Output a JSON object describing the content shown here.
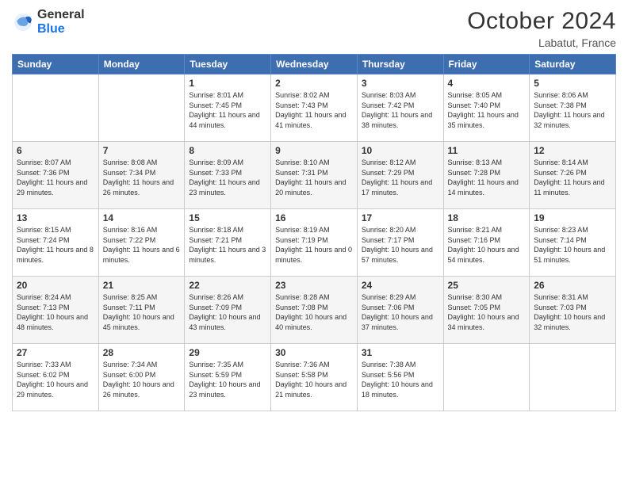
{
  "header": {
    "logo_line1": "General",
    "logo_line2": "Blue",
    "month_title": "October 2024",
    "location": "Labatut, France"
  },
  "weekdays": [
    "Sunday",
    "Monday",
    "Tuesday",
    "Wednesday",
    "Thursday",
    "Friday",
    "Saturday"
  ],
  "weeks": [
    [
      {
        "day": "",
        "sunrise": "",
        "sunset": "",
        "daylight": ""
      },
      {
        "day": "",
        "sunrise": "",
        "sunset": "",
        "daylight": ""
      },
      {
        "day": "1",
        "sunrise": "Sunrise: 8:01 AM",
        "sunset": "Sunset: 7:45 PM",
        "daylight": "Daylight: 11 hours and 44 minutes."
      },
      {
        "day": "2",
        "sunrise": "Sunrise: 8:02 AM",
        "sunset": "Sunset: 7:43 PM",
        "daylight": "Daylight: 11 hours and 41 minutes."
      },
      {
        "day": "3",
        "sunrise": "Sunrise: 8:03 AM",
        "sunset": "Sunset: 7:42 PM",
        "daylight": "Daylight: 11 hours and 38 minutes."
      },
      {
        "day": "4",
        "sunrise": "Sunrise: 8:05 AM",
        "sunset": "Sunset: 7:40 PM",
        "daylight": "Daylight: 11 hours and 35 minutes."
      },
      {
        "day": "5",
        "sunrise": "Sunrise: 8:06 AM",
        "sunset": "Sunset: 7:38 PM",
        "daylight": "Daylight: 11 hours and 32 minutes."
      }
    ],
    [
      {
        "day": "6",
        "sunrise": "Sunrise: 8:07 AM",
        "sunset": "Sunset: 7:36 PM",
        "daylight": "Daylight: 11 hours and 29 minutes."
      },
      {
        "day": "7",
        "sunrise": "Sunrise: 8:08 AM",
        "sunset": "Sunset: 7:34 PM",
        "daylight": "Daylight: 11 hours and 26 minutes."
      },
      {
        "day": "8",
        "sunrise": "Sunrise: 8:09 AM",
        "sunset": "Sunset: 7:33 PM",
        "daylight": "Daylight: 11 hours and 23 minutes."
      },
      {
        "day": "9",
        "sunrise": "Sunrise: 8:10 AM",
        "sunset": "Sunset: 7:31 PM",
        "daylight": "Daylight: 11 hours and 20 minutes."
      },
      {
        "day": "10",
        "sunrise": "Sunrise: 8:12 AM",
        "sunset": "Sunset: 7:29 PM",
        "daylight": "Daylight: 11 hours and 17 minutes."
      },
      {
        "day": "11",
        "sunrise": "Sunrise: 8:13 AM",
        "sunset": "Sunset: 7:28 PM",
        "daylight": "Daylight: 11 hours and 14 minutes."
      },
      {
        "day": "12",
        "sunrise": "Sunrise: 8:14 AM",
        "sunset": "Sunset: 7:26 PM",
        "daylight": "Daylight: 11 hours and 11 minutes."
      }
    ],
    [
      {
        "day": "13",
        "sunrise": "Sunrise: 8:15 AM",
        "sunset": "Sunset: 7:24 PM",
        "daylight": "Daylight: 11 hours and 8 minutes."
      },
      {
        "day": "14",
        "sunrise": "Sunrise: 8:16 AM",
        "sunset": "Sunset: 7:22 PM",
        "daylight": "Daylight: 11 hours and 6 minutes."
      },
      {
        "day": "15",
        "sunrise": "Sunrise: 8:18 AM",
        "sunset": "Sunset: 7:21 PM",
        "daylight": "Daylight: 11 hours and 3 minutes."
      },
      {
        "day": "16",
        "sunrise": "Sunrise: 8:19 AM",
        "sunset": "Sunset: 7:19 PM",
        "daylight": "Daylight: 11 hours and 0 minutes."
      },
      {
        "day": "17",
        "sunrise": "Sunrise: 8:20 AM",
        "sunset": "Sunset: 7:17 PM",
        "daylight": "Daylight: 10 hours and 57 minutes."
      },
      {
        "day": "18",
        "sunrise": "Sunrise: 8:21 AM",
        "sunset": "Sunset: 7:16 PM",
        "daylight": "Daylight: 10 hours and 54 minutes."
      },
      {
        "day": "19",
        "sunrise": "Sunrise: 8:23 AM",
        "sunset": "Sunset: 7:14 PM",
        "daylight": "Daylight: 10 hours and 51 minutes."
      }
    ],
    [
      {
        "day": "20",
        "sunrise": "Sunrise: 8:24 AM",
        "sunset": "Sunset: 7:13 PM",
        "daylight": "Daylight: 10 hours and 48 minutes."
      },
      {
        "day": "21",
        "sunrise": "Sunrise: 8:25 AM",
        "sunset": "Sunset: 7:11 PM",
        "daylight": "Daylight: 10 hours and 45 minutes."
      },
      {
        "day": "22",
        "sunrise": "Sunrise: 8:26 AM",
        "sunset": "Sunset: 7:09 PM",
        "daylight": "Daylight: 10 hours and 43 minutes."
      },
      {
        "day": "23",
        "sunrise": "Sunrise: 8:28 AM",
        "sunset": "Sunset: 7:08 PM",
        "daylight": "Daylight: 10 hours and 40 minutes."
      },
      {
        "day": "24",
        "sunrise": "Sunrise: 8:29 AM",
        "sunset": "Sunset: 7:06 PM",
        "daylight": "Daylight: 10 hours and 37 minutes."
      },
      {
        "day": "25",
        "sunrise": "Sunrise: 8:30 AM",
        "sunset": "Sunset: 7:05 PM",
        "daylight": "Daylight: 10 hours and 34 minutes."
      },
      {
        "day": "26",
        "sunrise": "Sunrise: 8:31 AM",
        "sunset": "Sunset: 7:03 PM",
        "daylight": "Daylight: 10 hours and 32 minutes."
      }
    ],
    [
      {
        "day": "27",
        "sunrise": "Sunrise: 7:33 AM",
        "sunset": "Sunset: 6:02 PM",
        "daylight": "Daylight: 10 hours and 29 minutes."
      },
      {
        "day": "28",
        "sunrise": "Sunrise: 7:34 AM",
        "sunset": "Sunset: 6:00 PM",
        "daylight": "Daylight: 10 hours and 26 minutes."
      },
      {
        "day": "29",
        "sunrise": "Sunrise: 7:35 AM",
        "sunset": "Sunset: 5:59 PM",
        "daylight": "Daylight: 10 hours and 23 minutes."
      },
      {
        "day": "30",
        "sunrise": "Sunrise: 7:36 AM",
        "sunset": "Sunset: 5:58 PM",
        "daylight": "Daylight: 10 hours and 21 minutes."
      },
      {
        "day": "31",
        "sunrise": "Sunrise: 7:38 AM",
        "sunset": "Sunset: 5:56 PM",
        "daylight": "Daylight: 10 hours and 18 minutes."
      },
      {
        "day": "",
        "sunrise": "",
        "sunset": "",
        "daylight": ""
      },
      {
        "day": "",
        "sunrise": "",
        "sunset": "",
        "daylight": ""
      }
    ]
  ]
}
